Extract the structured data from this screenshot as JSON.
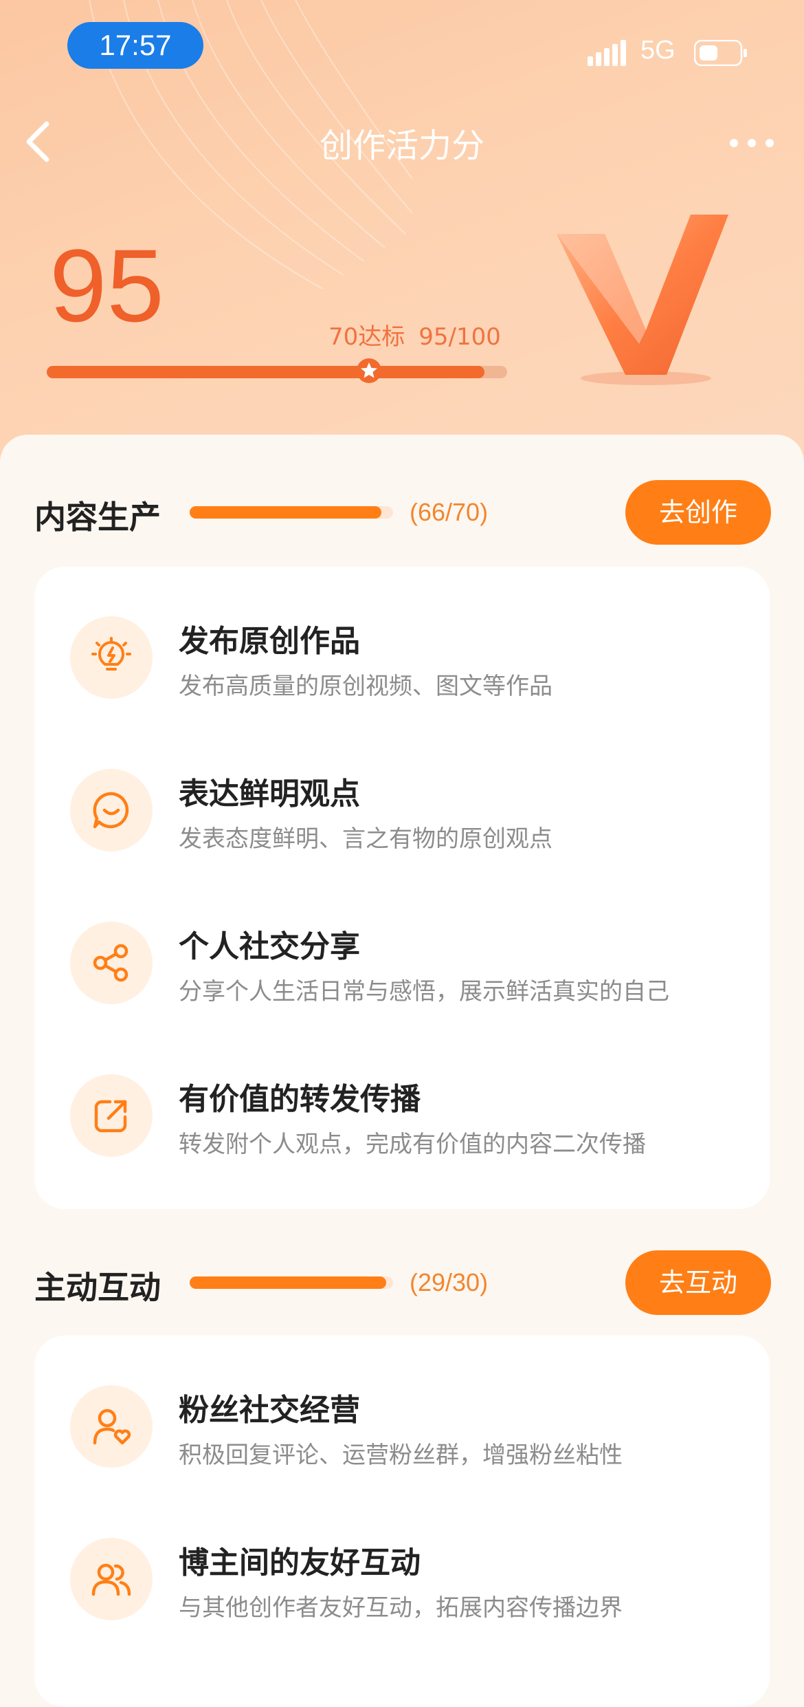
{
  "status_bar": {
    "time": "17:57",
    "network": "5G"
  },
  "nav": {
    "title": "创作活力分"
  },
  "score": {
    "value": "95",
    "target_label": "70达标",
    "ratio_label": "95/100",
    "progress": 0.95,
    "target_position": 0.7
  },
  "sections": [
    {
      "title": "内容生产",
      "count": "(66/70)",
      "progress": 0.943,
      "button": "去创作",
      "items": [
        {
          "icon": "lightbulb-icon",
          "title": "发布原创作品",
          "desc": "发布高质量的原创视频、图文等作品"
        },
        {
          "icon": "chat-bubble-icon",
          "title": "表达鲜明观点",
          "desc": "发表态度鲜明、言之有物的原创观点"
        },
        {
          "icon": "share-icon",
          "title": "个人社交分享",
          "desc": "分享个人生活日常与感悟，展示鲜活真实的自己"
        },
        {
          "icon": "forward-icon",
          "title": "有价值的转发传播",
          "desc": "转发附个人观点，完成有价值的内容二次传播"
        }
      ]
    },
    {
      "title": "主动互动",
      "count": "(29/30)",
      "progress": 0.967,
      "button": "去互动",
      "items": [
        {
          "icon": "user-heart-icon",
          "title": "粉丝社交经营",
          "desc": "积极回复评论、运营粉丝群，增强粉丝粘性"
        },
        {
          "icon": "users-icon",
          "title": "博主间的友好互动",
          "desc": "与其他创作者友好互动，拓展内容传播边界"
        }
      ]
    }
  ],
  "colors": {
    "accent": "#ff7f16",
    "score": "#f0602a",
    "status_pill": "#1a7de8"
  }
}
